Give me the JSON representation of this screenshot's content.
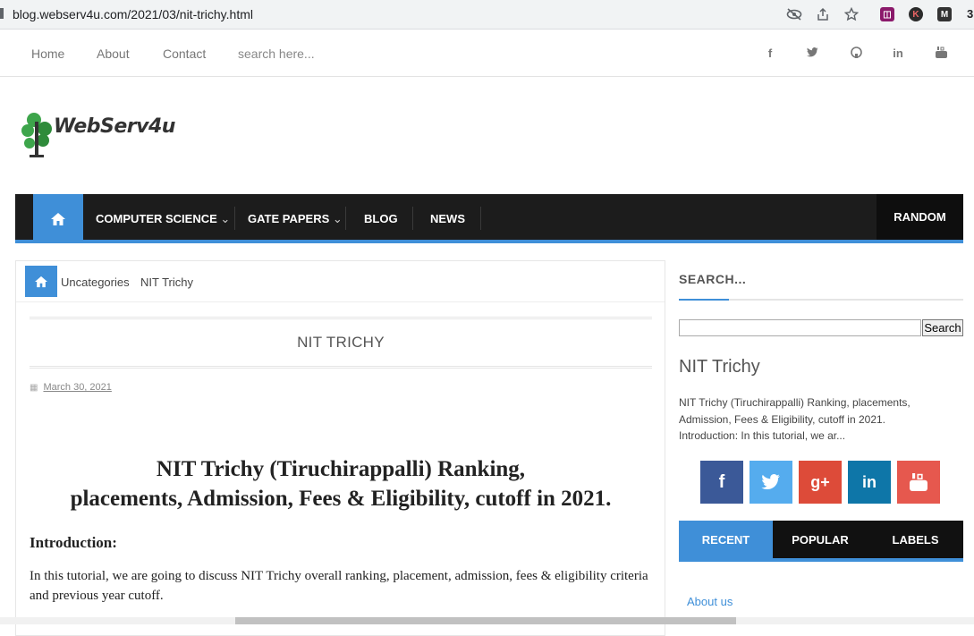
{
  "browser": {
    "url": "blog.webserv4u.com/2021/03/nit-trichy.html",
    "icons": [
      "eye-off-icon",
      "share-icon",
      "star-icon"
    ],
    "ext_k": "K",
    "ext_m": "M",
    "ext_count": "3"
  },
  "topnav": {
    "items": [
      {
        "label": "Home"
      },
      {
        "label": "About"
      },
      {
        "label": "Contact"
      }
    ],
    "search_placeholder": "search here...",
    "social": [
      "f",
      "🐦",
      "◯",
      "in",
      "▶"
    ]
  },
  "logo": {
    "text": "WebServ4u"
  },
  "menu": {
    "items": [
      {
        "label": "COMPUTER SCIENCE"
      },
      {
        "label": "GATE PAPERS"
      },
      {
        "label": "BLOG"
      },
      {
        "label": "NEWS"
      }
    ],
    "random": "RANDOM"
  },
  "post": {
    "breadcrumb": [
      "Uncategories",
      "NIT Trichy"
    ],
    "title": "NIT TRICHY",
    "date": "March 30, 2021",
    "heading_line1": "NIT Trichy (Tiruchirappalli) Ranking,",
    "heading_line2": "placements, Admission, Fees & Eligibility, cutoff in 2021.",
    "intro_label": "Introduction:",
    "paragraph": "In this tutorial, we are going to discuss  NIT Trichy overall ranking, placement, admission, fees & eligibility criteria and previous year cutoff."
  },
  "sidebar": {
    "search_heading": "SEARCH...",
    "search_button": "Search",
    "popular_title": "NIT Trichy",
    "popular_snippet": "  NIT Trichy (Tiruchirappalli) Ranking, placements, Admission, Fees & Eligibility, cutoff in 2021. Introduction: In this tutorial, we ar...",
    "social_colors": {
      "facebook": "#3b5998",
      "twitter": "#55acee",
      "googleplus": "#dd4b39",
      "linkedin": "#0e76a8",
      "youtube": "#e6584e"
    },
    "tabs": [
      {
        "label": "RECENT"
      },
      {
        "label": "POPULAR"
      },
      {
        "label": "LABELS"
      }
    ],
    "link": "About us"
  },
  "colors": {
    "accent": "#3f8fd8",
    "menu_bg": "#1c1c1c"
  }
}
